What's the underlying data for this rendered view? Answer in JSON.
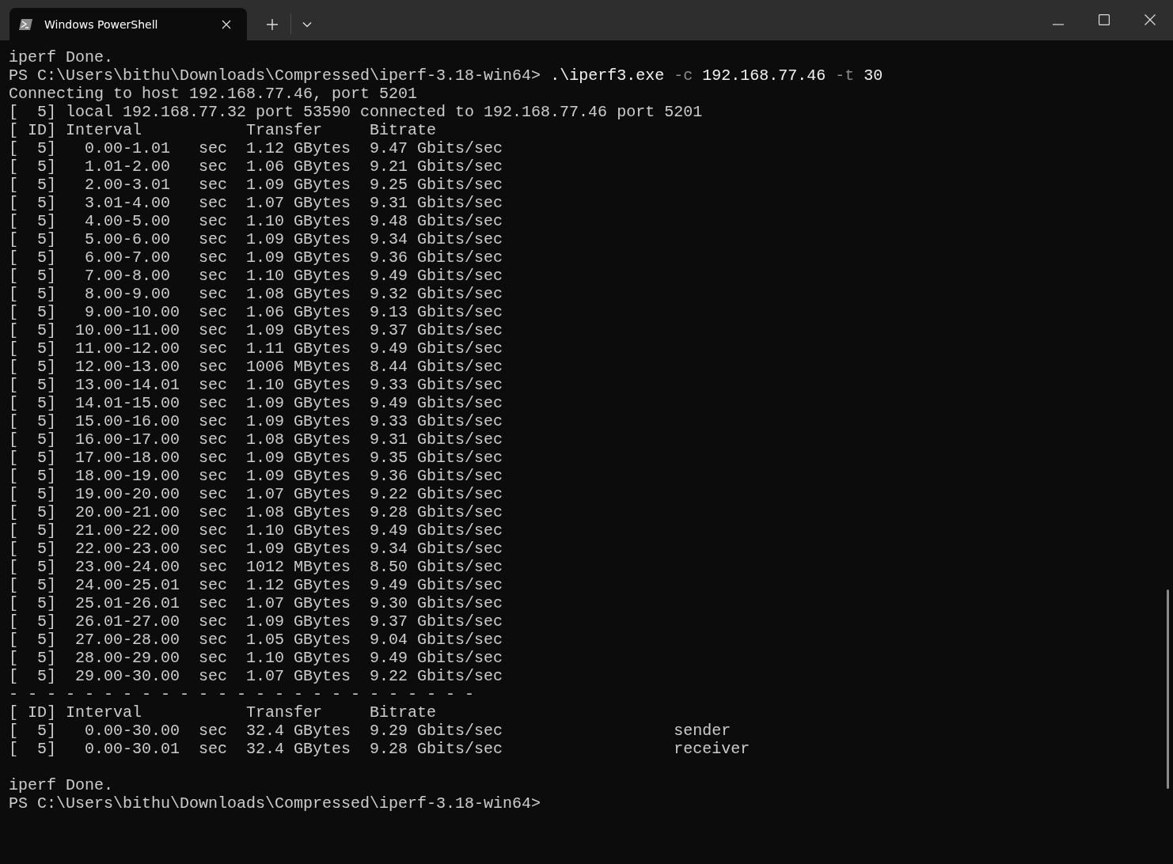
{
  "tabs": [
    {
      "title": "Windows PowerShell",
      "selected": true
    }
  ],
  "lines": [
    {
      "kind": "output",
      "text": "iperf Done."
    },
    {
      "kind": "command",
      "prompt": "PS C:\\Users\\bithu\\Downloads\\Compressed\\iperf-3.18-win64> ",
      "parts": [
        {
          "kind": "name",
          "text": ".\\iperf3.exe"
        },
        {
          "kind": "param",
          "text": "-c"
        },
        {
          "kind": "arg",
          "text": "192.168.77.46"
        },
        {
          "kind": "param",
          "text": "-t"
        },
        {
          "kind": "arg",
          "text": "30"
        }
      ]
    },
    {
      "kind": "output",
      "text": "Connecting to host 192.168.77.46, port 5201"
    },
    {
      "kind": "output",
      "text": "[  5] local 192.168.77.32 port 53590 connected to 192.168.77.46 port 5201"
    },
    {
      "kind": "output",
      "text": "[ ID] Interval           Transfer     Bitrate"
    },
    {
      "kind": "output",
      "text": "[  5]   0.00-1.01   sec  1.12 GBytes  9.47 Gbits/sec"
    },
    {
      "kind": "output",
      "text": "[  5]   1.01-2.00   sec  1.06 GBytes  9.21 Gbits/sec"
    },
    {
      "kind": "output",
      "text": "[  5]   2.00-3.01   sec  1.09 GBytes  9.25 Gbits/sec"
    },
    {
      "kind": "output",
      "text": "[  5]   3.01-4.00   sec  1.07 GBytes  9.31 Gbits/sec"
    },
    {
      "kind": "output",
      "text": "[  5]   4.00-5.00   sec  1.10 GBytes  9.48 Gbits/sec"
    },
    {
      "kind": "output",
      "text": "[  5]   5.00-6.00   sec  1.09 GBytes  9.34 Gbits/sec"
    },
    {
      "kind": "output",
      "text": "[  5]   6.00-7.00   sec  1.09 GBytes  9.36 Gbits/sec"
    },
    {
      "kind": "output",
      "text": "[  5]   7.00-8.00   sec  1.10 GBytes  9.49 Gbits/sec"
    },
    {
      "kind": "output",
      "text": "[  5]   8.00-9.00   sec  1.08 GBytes  9.32 Gbits/sec"
    },
    {
      "kind": "output",
      "text": "[  5]   9.00-10.00  sec  1.06 GBytes  9.13 Gbits/sec"
    },
    {
      "kind": "output",
      "text": "[  5]  10.00-11.00  sec  1.09 GBytes  9.37 Gbits/sec"
    },
    {
      "kind": "output",
      "text": "[  5]  11.00-12.00  sec  1.11 GBytes  9.49 Gbits/sec"
    },
    {
      "kind": "output",
      "text": "[  5]  12.00-13.00  sec  1006 MBytes  8.44 Gbits/sec"
    },
    {
      "kind": "output",
      "text": "[  5]  13.00-14.01  sec  1.10 GBytes  9.33 Gbits/sec"
    },
    {
      "kind": "output",
      "text": "[  5]  14.01-15.00  sec  1.09 GBytes  9.49 Gbits/sec"
    },
    {
      "kind": "output",
      "text": "[  5]  15.00-16.00  sec  1.09 GBytes  9.33 Gbits/sec"
    },
    {
      "kind": "output",
      "text": "[  5]  16.00-17.00  sec  1.08 GBytes  9.31 Gbits/sec"
    },
    {
      "kind": "output",
      "text": "[  5]  17.00-18.00  sec  1.09 GBytes  9.35 Gbits/sec"
    },
    {
      "kind": "output",
      "text": "[  5]  18.00-19.00  sec  1.09 GBytes  9.36 Gbits/sec"
    },
    {
      "kind": "output",
      "text": "[  5]  19.00-20.00  sec  1.07 GBytes  9.22 Gbits/sec"
    },
    {
      "kind": "output",
      "text": "[  5]  20.00-21.00  sec  1.08 GBytes  9.28 Gbits/sec"
    },
    {
      "kind": "output",
      "text": "[  5]  21.00-22.00  sec  1.10 GBytes  9.49 Gbits/sec"
    },
    {
      "kind": "output",
      "text": "[  5]  22.00-23.00  sec  1.09 GBytes  9.34 Gbits/sec"
    },
    {
      "kind": "output",
      "text": "[  5]  23.00-24.00  sec  1012 MBytes  8.50 Gbits/sec"
    },
    {
      "kind": "output",
      "text": "[  5]  24.00-25.01  sec  1.12 GBytes  9.49 Gbits/sec"
    },
    {
      "kind": "output",
      "text": "[  5]  25.01-26.01  sec  1.07 GBytes  9.30 Gbits/sec"
    },
    {
      "kind": "output",
      "text": "[  5]  26.01-27.00  sec  1.09 GBytes  9.37 Gbits/sec"
    },
    {
      "kind": "output",
      "text": "[  5]  27.00-28.00  sec  1.05 GBytes  9.04 Gbits/sec"
    },
    {
      "kind": "output",
      "text": "[  5]  28.00-29.00  sec  1.10 GBytes  9.49 Gbits/sec"
    },
    {
      "kind": "output",
      "text": "[  5]  29.00-30.00  sec  1.07 GBytes  9.22 Gbits/sec"
    },
    {
      "kind": "output",
      "text": "- - - - - - - - - - - - - - - - - - - - - - - - -"
    },
    {
      "kind": "output",
      "text": "[ ID] Interval           Transfer     Bitrate"
    },
    {
      "kind": "output",
      "text": "[  5]   0.00-30.00  sec  32.4 GBytes  9.29 Gbits/sec                  sender"
    },
    {
      "kind": "output",
      "text": "[  5]   0.00-30.01  sec  32.4 GBytes  9.28 Gbits/sec                  receiver"
    },
    {
      "kind": "blank"
    },
    {
      "kind": "output",
      "text": "iperf Done."
    },
    {
      "kind": "prompt",
      "text": "PS C:\\Users\\bithu\\Downloads\\Compressed\\iperf-3.18-win64>"
    }
  ]
}
